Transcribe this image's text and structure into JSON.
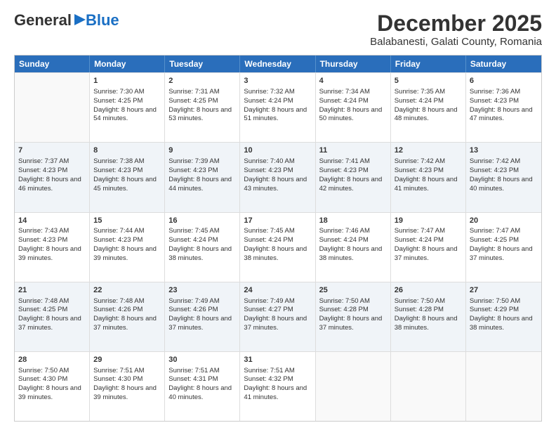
{
  "logo": {
    "general": "General",
    "blue": "Blue"
  },
  "header": {
    "title": "December 2025",
    "subtitle": "Balabanesti, Galati County, Romania"
  },
  "days": [
    "Sunday",
    "Monday",
    "Tuesday",
    "Wednesday",
    "Thursday",
    "Friday",
    "Saturday"
  ],
  "weeks": [
    [
      {
        "day": "",
        "sunrise": "",
        "sunset": "",
        "daylight": ""
      },
      {
        "day": "1",
        "sunrise": "Sunrise: 7:30 AM",
        "sunset": "Sunset: 4:25 PM",
        "daylight": "Daylight: 8 hours and 54 minutes."
      },
      {
        "day": "2",
        "sunrise": "Sunrise: 7:31 AM",
        "sunset": "Sunset: 4:25 PM",
        "daylight": "Daylight: 8 hours and 53 minutes."
      },
      {
        "day": "3",
        "sunrise": "Sunrise: 7:32 AM",
        "sunset": "Sunset: 4:24 PM",
        "daylight": "Daylight: 8 hours and 51 minutes."
      },
      {
        "day": "4",
        "sunrise": "Sunrise: 7:34 AM",
        "sunset": "Sunset: 4:24 PM",
        "daylight": "Daylight: 8 hours and 50 minutes."
      },
      {
        "day": "5",
        "sunrise": "Sunrise: 7:35 AM",
        "sunset": "Sunset: 4:24 PM",
        "daylight": "Daylight: 8 hours and 48 minutes."
      },
      {
        "day": "6",
        "sunrise": "Sunrise: 7:36 AM",
        "sunset": "Sunset: 4:23 PM",
        "daylight": "Daylight: 8 hours and 47 minutes."
      }
    ],
    [
      {
        "day": "7",
        "sunrise": "Sunrise: 7:37 AM",
        "sunset": "Sunset: 4:23 PM",
        "daylight": "Daylight: 8 hours and 46 minutes."
      },
      {
        "day": "8",
        "sunrise": "Sunrise: 7:38 AM",
        "sunset": "Sunset: 4:23 PM",
        "daylight": "Daylight: 8 hours and 45 minutes."
      },
      {
        "day": "9",
        "sunrise": "Sunrise: 7:39 AM",
        "sunset": "Sunset: 4:23 PM",
        "daylight": "Daylight: 8 hours and 44 minutes."
      },
      {
        "day": "10",
        "sunrise": "Sunrise: 7:40 AM",
        "sunset": "Sunset: 4:23 PM",
        "daylight": "Daylight: 8 hours and 43 minutes."
      },
      {
        "day": "11",
        "sunrise": "Sunrise: 7:41 AM",
        "sunset": "Sunset: 4:23 PM",
        "daylight": "Daylight: 8 hours and 42 minutes."
      },
      {
        "day": "12",
        "sunrise": "Sunrise: 7:42 AM",
        "sunset": "Sunset: 4:23 PM",
        "daylight": "Daylight: 8 hours and 41 minutes."
      },
      {
        "day": "13",
        "sunrise": "Sunrise: 7:42 AM",
        "sunset": "Sunset: 4:23 PM",
        "daylight": "Daylight: 8 hours and 40 minutes."
      }
    ],
    [
      {
        "day": "14",
        "sunrise": "Sunrise: 7:43 AM",
        "sunset": "Sunset: 4:23 PM",
        "daylight": "Daylight: 8 hours and 39 minutes."
      },
      {
        "day": "15",
        "sunrise": "Sunrise: 7:44 AM",
        "sunset": "Sunset: 4:23 PM",
        "daylight": "Daylight: 8 hours and 39 minutes."
      },
      {
        "day": "16",
        "sunrise": "Sunrise: 7:45 AM",
        "sunset": "Sunset: 4:24 PM",
        "daylight": "Daylight: 8 hours and 38 minutes."
      },
      {
        "day": "17",
        "sunrise": "Sunrise: 7:45 AM",
        "sunset": "Sunset: 4:24 PM",
        "daylight": "Daylight: 8 hours and 38 minutes."
      },
      {
        "day": "18",
        "sunrise": "Sunrise: 7:46 AM",
        "sunset": "Sunset: 4:24 PM",
        "daylight": "Daylight: 8 hours and 38 minutes."
      },
      {
        "day": "19",
        "sunrise": "Sunrise: 7:47 AM",
        "sunset": "Sunset: 4:24 PM",
        "daylight": "Daylight: 8 hours and 37 minutes."
      },
      {
        "day": "20",
        "sunrise": "Sunrise: 7:47 AM",
        "sunset": "Sunset: 4:25 PM",
        "daylight": "Daylight: 8 hours and 37 minutes."
      }
    ],
    [
      {
        "day": "21",
        "sunrise": "Sunrise: 7:48 AM",
        "sunset": "Sunset: 4:25 PM",
        "daylight": "Daylight: 8 hours and 37 minutes."
      },
      {
        "day": "22",
        "sunrise": "Sunrise: 7:48 AM",
        "sunset": "Sunset: 4:26 PM",
        "daylight": "Daylight: 8 hours and 37 minutes."
      },
      {
        "day": "23",
        "sunrise": "Sunrise: 7:49 AM",
        "sunset": "Sunset: 4:26 PM",
        "daylight": "Daylight: 8 hours and 37 minutes."
      },
      {
        "day": "24",
        "sunrise": "Sunrise: 7:49 AM",
        "sunset": "Sunset: 4:27 PM",
        "daylight": "Daylight: 8 hours and 37 minutes."
      },
      {
        "day": "25",
        "sunrise": "Sunrise: 7:50 AM",
        "sunset": "Sunset: 4:28 PM",
        "daylight": "Daylight: 8 hours and 37 minutes."
      },
      {
        "day": "26",
        "sunrise": "Sunrise: 7:50 AM",
        "sunset": "Sunset: 4:28 PM",
        "daylight": "Daylight: 8 hours and 38 minutes."
      },
      {
        "day": "27",
        "sunrise": "Sunrise: 7:50 AM",
        "sunset": "Sunset: 4:29 PM",
        "daylight": "Daylight: 8 hours and 38 minutes."
      }
    ],
    [
      {
        "day": "28",
        "sunrise": "Sunrise: 7:50 AM",
        "sunset": "Sunset: 4:30 PM",
        "daylight": "Daylight: 8 hours and 39 minutes."
      },
      {
        "day": "29",
        "sunrise": "Sunrise: 7:51 AM",
        "sunset": "Sunset: 4:30 PM",
        "daylight": "Daylight: 8 hours and 39 minutes."
      },
      {
        "day": "30",
        "sunrise": "Sunrise: 7:51 AM",
        "sunset": "Sunset: 4:31 PM",
        "daylight": "Daylight: 8 hours and 40 minutes."
      },
      {
        "day": "31",
        "sunrise": "Sunrise: 7:51 AM",
        "sunset": "Sunset: 4:32 PM",
        "daylight": "Daylight: 8 hours and 41 minutes."
      },
      {
        "day": "",
        "sunrise": "",
        "sunset": "",
        "daylight": ""
      },
      {
        "day": "",
        "sunrise": "",
        "sunset": "",
        "daylight": ""
      },
      {
        "day": "",
        "sunrise": "",
        "sunset": "",
        "daylight": ""
      }
    ]
  ]
}
